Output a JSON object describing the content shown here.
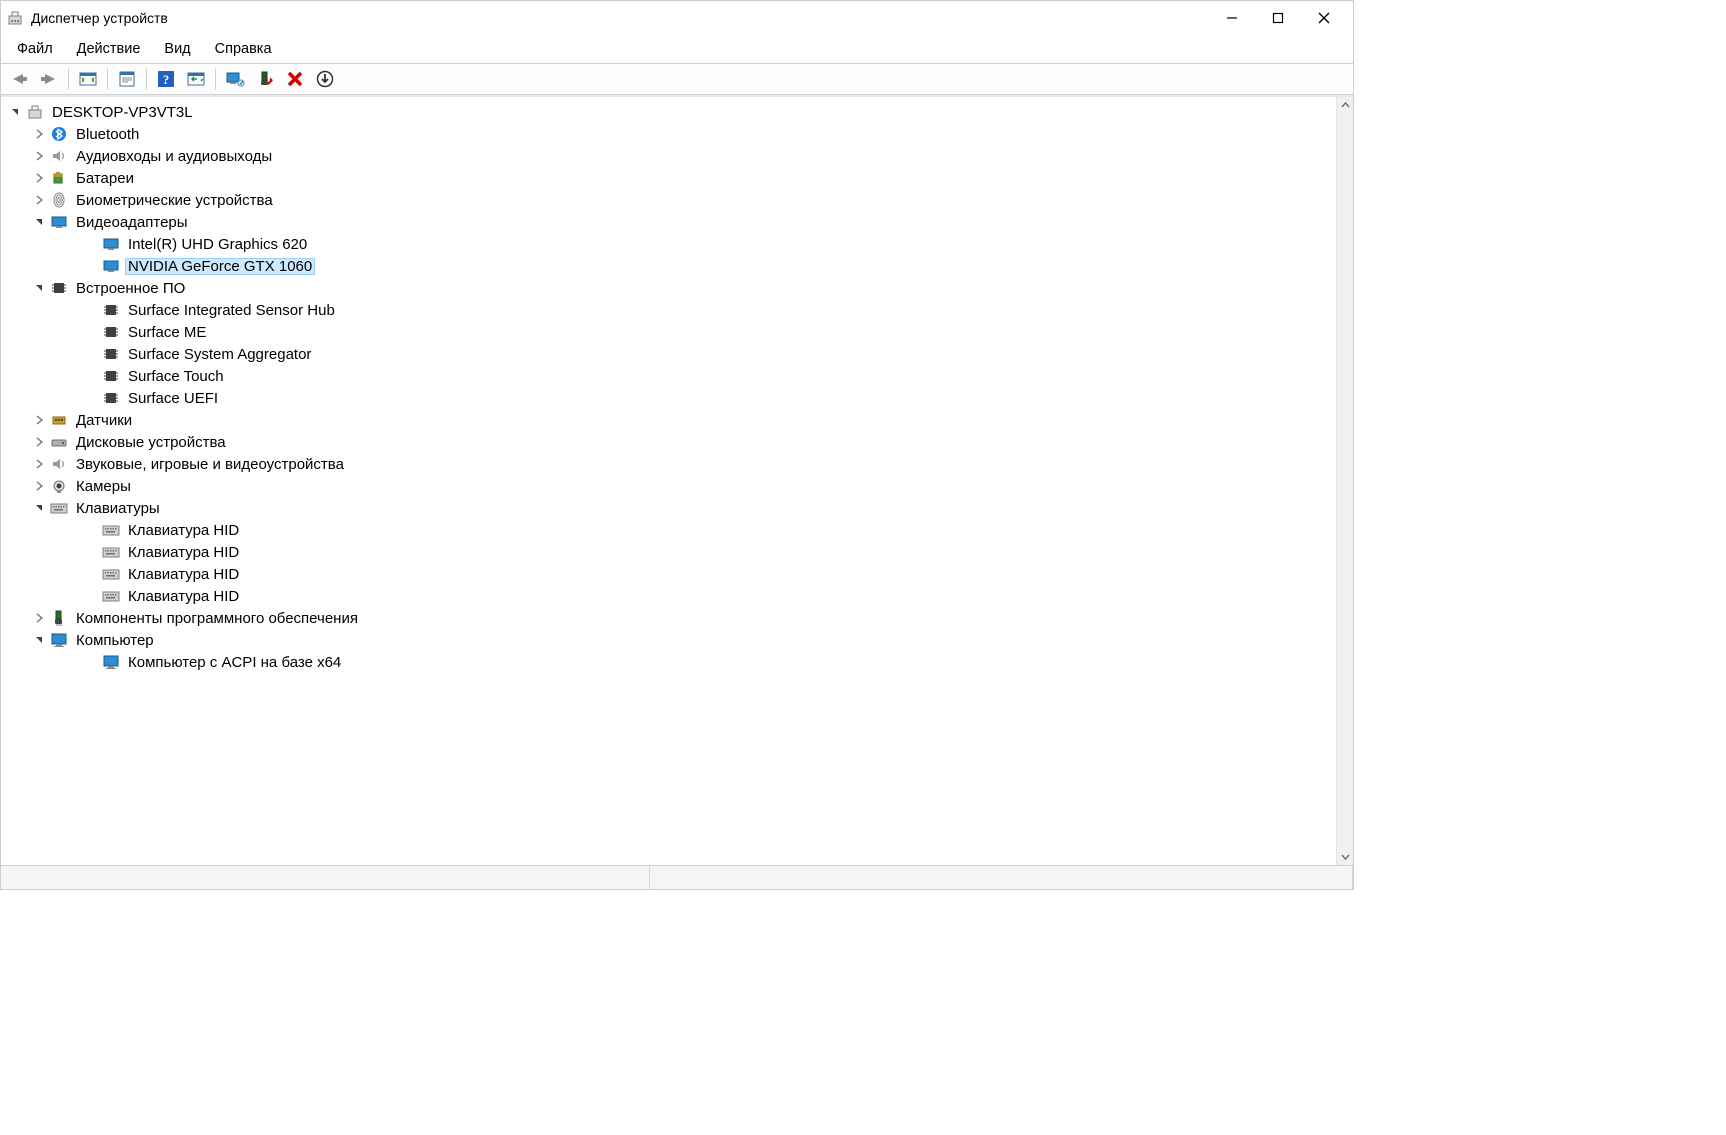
{
  "title": "Диспетчер устройств",
  "menu": {
    "file": "Файл",
    "action": "Действие",
    "view": "Вид",
    "help": "Справка"
  },
  "toolbar": {
    "back": "back-icon",
    "forward": "forward-icon",
    "show_hide": "show-hide-console-tree-icon",
    "properties": "properties-icon",
    "help": "help-icon",
    "scan": "scan-hardware-icon",
    "update": "update-driver-icon",
    "uninstall_device": "uninstall-device-icon",
    "disable": "disable-device-icon",
    "add_legacy": "add-legacy-hardware-icon"
  },
  "root": "DESKTOP-VP3VT3L",
  "categories": {
    "bluetooth": "Bluetooth",
    "audio_io": "Аудиовходы и аудиовыходы",
    "batteries": "Батареи",
    "biometric": "Биометрические устройства",
    "display": "Видеоадаптеры",
    "firmware": "Встроенное ПО",
    "sensors": "Датчики",
    "disk": "Дисковые устройства",
    "sound_game": "Звуковые, игровые и видеоустройства",
    "cameras": "Камеры",
    "keyboards": "Клавиатуры",
    "software_components": "Компоненты программного обеспечения",
    "computer": "Компьютер"
  },
  "devices": {
    "display_0": "Intel(R) UHD Graphics 620",
    "display_1": "NVIDIA GeForce GTX 1060",
    "firmware_0": "Surface Integrated Sensor Hub",
    "firmware_1": "Surface ME",
    "firmware_2": "Surface System Aggregator",
    "firmware_3": "Surface Touch",
    "firmware_4": "Surface UEFI",
    "keyboard_0": "Клавиатура HID",
    "keyboard_1": "Клавиатура HID",
    "keyboard_2": "Клавиатура HID",
    "keyboard_3": "Клавиатура HID",
    "computer_0": "Компьютер с ACPI на базе x64"
  }
}
